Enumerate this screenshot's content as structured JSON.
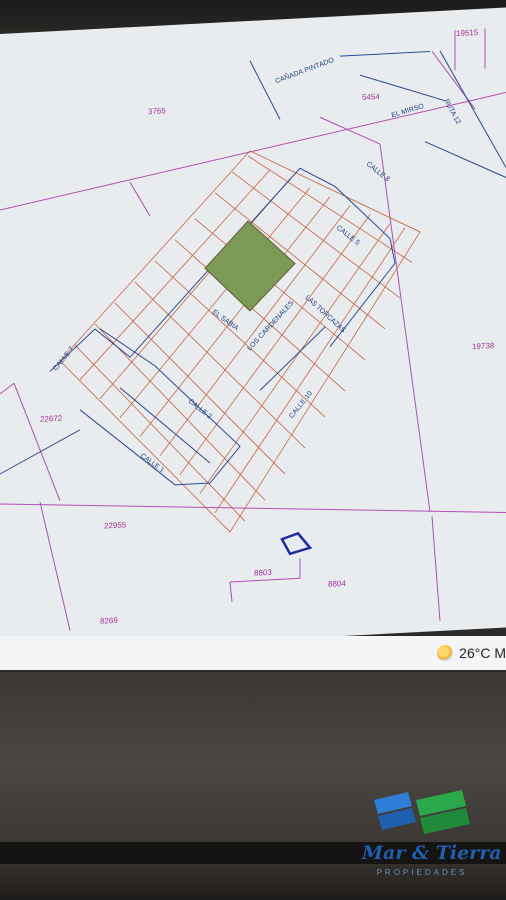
{
  "map": {
    "parcel_numbers": [
      "19515",
      "3765",
      "5454",
      "19738",
      "22672",
      "22955",
      "8803",
      "8804",
      "8269"
    ],
    "street_names": [
      "CAÑADA PINTADO",
      "EL MIRSO",
      "RUTA 12",
      "CALLE 8",
      "CALLE 5",
      "EL SABIA",
      "LOS CARDENALES",
      "LAS TORCAZAS",
      "CALLE 7",
      "CALLE 2",
      "CALLE 10",
      "CALLE 1"
    ],
    "colors": {
      "parcel_lines": "#b14fb0",
      "lot_lines": "#c9633f",
      "street_lines": "#2c4a94",
      "highlight_green": "#7a9a55",
      "selected_outline": "#1b2fa3"
    }
  },
  "taskbar": {
    "weather_icon": "partly-sunny-icon",
    "weather_text": "26°C M"
  },
  "watermark": {
    "name": "Mar & Tierra",
    "sub": "PROPIEDADES"
  }
}
